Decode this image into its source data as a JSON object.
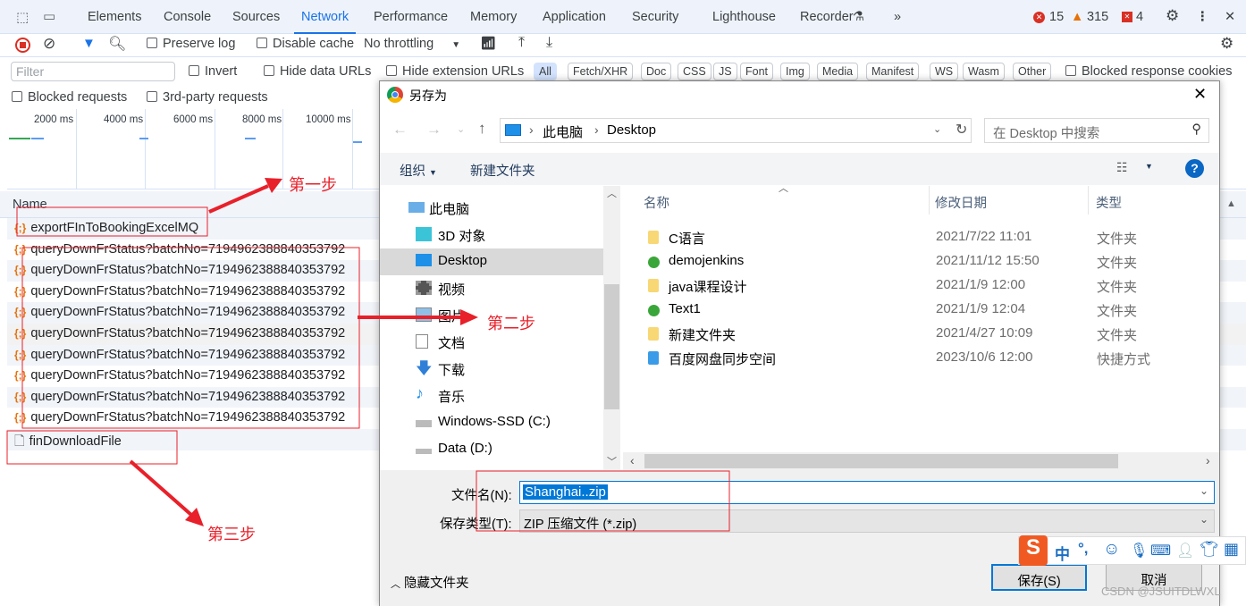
{
  "devtools": {
    "tabs": [
      "Elements",
      "Console",
      "Sources",
      "Network",
      "Performance",
      "Memory",
      "Application",
      "Security",
      "Lighthouse",
      "Recorder"
    ],
    "active_tab": "Network",
    "counts": {
      "errors": "15",
      "warnings": "315",
      "issues": "4"
    },
    "toolbar": {
      "preserve_log": "Preserve log",
      "disable_cache": "Disable cache",
      "throttling": "No throttling"
    },
    "filter": {
      "placeholder": "Filter",
      "invert": "Invert",
      "hide_data_urls": "Hide data URLs",
      "hide_ext_urls": "Hide extension URLs",
      "blocked_cookies": "Blocked response cookies",
      "blocked_requests": "Blocked requests",
      "third_party": "3rd-party requests"
    },
    "types": [
      "All",
      "Fetch/XHR",
      "Doc",
      "CSS",
      "JS",
      "Font",
      "Img",
      "Media",
      "Manifest",
      "WS",
      "Wasm",
      "Other"
    ],
    "overview_ticks": [
      "2000 ms",
      "4000 ms",
      "6000 ms",
      "8000 ms",
      "10000 ms"
    ],
    "name_header": "Name",
    "requests": [
      "exportFInToBookingExcelMQ",
      "queryDownFrStatus?batchNo=7194962388840353792",
      "queryDownFrStatus?batchNo=7194962388840353792",
      "queryDownFrStatus?batchNo=7194962388840353792",
      "queryDownFrStatus?batchNo=7194962388840353792",
      "queryDownFrStatus?batchNo=7194962388840353792",
      "queryDownFrStatus?batchNo=7194962388840353792",
      "queryDownFrStatus?batchNo=7194962388840353792",
      "queryDownFrStatus?batchNo=7194962388840353792",
      "queryDownFrStatus?batchNo=7194962388840353792",
      "finDownloadFile"
    ]
  },
  "dialog": {
    "title": "另存为",
    "breadcrumb": [
      "此电脑",
      "Desktop"
    ],
    "search_placeholder": "在 Desktop 中搜索",
    "organize": "组织",
    "new_folder": "新建文件夹",
    "nav": [
      "此电脑",
      "3D 对象",
      "Desktop",
      "视频",
      "图片",
      "文档",
      "下载",
      "音乐",
      "Windows-SSD (C:)",
      "Data (D:)"
    ],
    "nav_selected": "Desktop",
    "columns": [
      "名称",
      "修改日期",
      "类型"
    ],
    "files": [
      {
        "name": "C语言",
        "date": "2021/7/22 11:01",
        "type": "文件夹",
        "icon": "folder"
      },
      {
        "name": "demojenkins",
        "date": "2021/11/12 15:50",
        "type": "文件夹",
        "icon": "folder-synced"
      },
      {
        "name": "java课程设计",
        "date": "2021/1/9 12:00",
        "type": "文件夹",
        "icon": "folder"
      },
      {
        "name": "Text1",
        "date": "2021/1/9 12:04",
        "type": "文件夹",
        "icon": "folder-synced"
      },
      {
        "name": "新建文件夹",
        "date": "2021/4/27 10:09",
        "type": "文件夹",
        "icon": "folder"
      },
      {
        "name": "百度网盘同步空间",
        "date": "2023/10/6 12:00",
        "type": "快捷方式",
        "icon": "shortcut"
      }
    ],
    "filename_label": "文件名(N):",
    "filename_value": "Shanghai..zip",
    "filetype_label": "保存类型(T):",
    "filetype_value": "ZIP 压缩文件 (*.zip)",
    "hide_folders": "隐藏文件夹",
    "save": "保存(S)",
    "cancel": "取消"
  },
  "ime": {
    "mode": "中",
    "punct": "°,"
  },
  "annotations": {
    "step1": "第一步",
    "step2": "第二步",
    "step3": "第三步",
    "annotation_color": "#e8202a"
  },
  "watermark": "CSDN @JSUITDLWXL"
}
